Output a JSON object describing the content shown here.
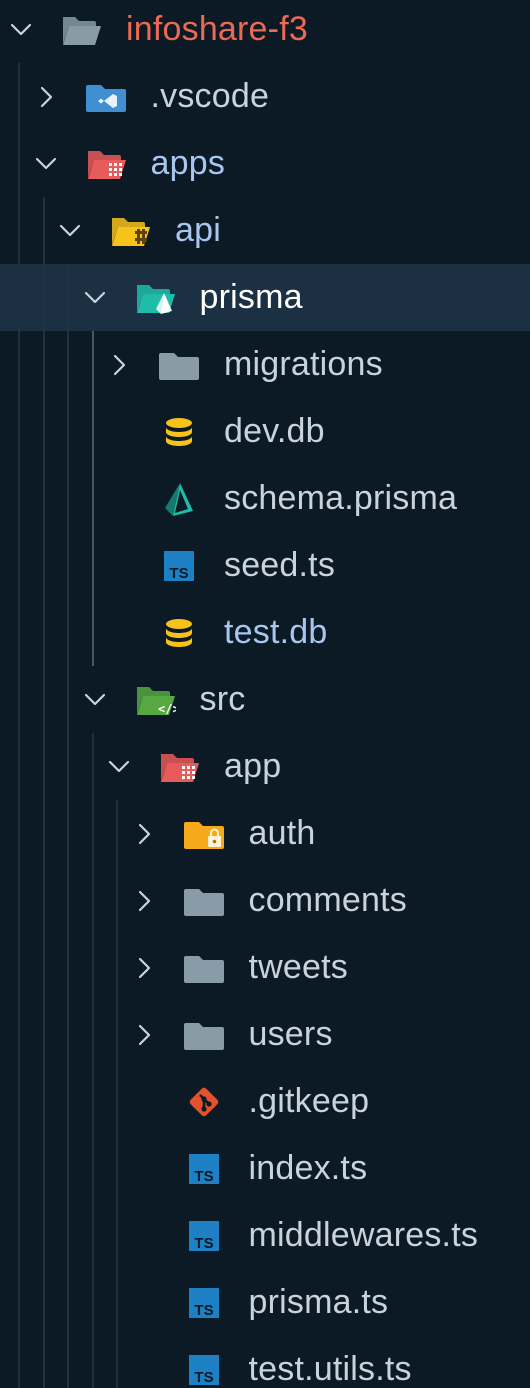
{
  "explorer": {
    "items": [
      {
        "label": "infoshare-f3",
        "depth": 0,
        "expanded": true,
        "type": "folder-root",
        "color": "#ec6a55"
      },
      {
        "label": ".vscode",
        "depth": 1,
        "expanded": false,
        "type": "folder-vscode",
        "color": "#c9d3dc"
      },
      {
        "label": "apps",
        "depth": 1,
        "expanded": true,
        "type": "folder-apps",
        "color": "#a9c6ee"
      },
      {
        "label": "api",
        "depth": 2,
        "expanded": true,
        "type": "folder-api",
        "color": "#a9c6ee"
      },
      {
        "label": "prisma",
        "depth": 3,
        "expanded": true,
        "type": "folder-prisma",
        "color": "#ffffff",
        "selected": true
      },
      {
        "label": "migrations",
        "depth": 4,
        "expanded": false,
        "type": "folder-generic",
        "color": "#c9d3dc"
      },
      {
        "label": "dev.db",
        "depth": 4,
        "type": "file-db",
        "color": "#c9d3dc"
      },
      {
        "label": "schema.prisma",
        "depth": 4,
        "type": "file-prisma",
        "color": "#c9d3dc"
      },
      {
        "label": "seed.ts",
        "depth": 4,
        "type": "file-ts",
        "color": "#c9d3dc"
      },
      {
        "label": "test.db",
        "depth": 4,
        "type": "file-db",
        "color": "#a9c6ee"
      },
      {
        "label": "src",
        "depth": 3,
        "expanded": true,
        "type": "folder-src",
        "color": "#c9d3dc"
      },
      {
        "label": "app",
        "depth": 4,
        "expanded": true,
        "type": "folder-apps",
        "color": "#c9d3dc"
      },
      {
        "label": "auth",
        "depth": 5,
        "expanded": false,
        "type": "folder-auth",
        "color": "#c9d3dc"
      },
      {
        "label": "comments",
        "depth": 5,
        "expanded": false,
        "type": "folder-generic",
        "color": "#c9d3dc"
      },
      {
        "label": "tweets",
        "depth": 5,
        "expanded": false,
        "type": "folder-generic",
        "color": "#c9d3dc"
      },
      {
        "label": "users",
        "depth": 5,
        "expanded": false,
        "type": "folder-generic",
        "color": "#c9d3dc"
      },
      {
        "label": ".gitkeep",
        "depth": 5,
        "type": "file-git",
        "color": "#c9d3dc"
      },
      {
        "label": "index.ts",
        "depth": 5,
        "type": "file-ts",
        "color": "#c9d3dc"
      },
      {
        "label": "middlewares.ts",
        "depth": 5,
        "type": "file-ts",
        "color": "#c9d3dc"
      },
      {
        "label": "prisma.ts",
        "depth": 5,
        "type": "file-ts",
        "color": "#c9d3dc"
      },
      {
        "label": "test.utils.ts",
        "depth": 5,
        "type": "file-ts",
        "color": "#c9d3dc"
      }
    ]
  },
  "icon_names": {
    "folder-root": "open-folder-icon",
    "folder-vscode": "vscode-folder-icon",
    "folder-apps": "apps-folder-icon",
    "folder-api": "api-folder-icon",
    "folder-prisma": "prisma-folder-icon",
    "folder-generic": "folder-icon",
    "folder-src": "src-folder-icon",
    "folder-auth": "auth-folder-icon",
    "file-db": "database-icon",
    "file-prisma": "prisma-file-icon",
    "file-ts": "typescript-icon",
    "file-git": "git-icon"
  },
  "colors": {
    "background": "#0b1a25",
    "selection": "#1b3042",
    "chevron": "#c9d3dc",
    "guide": "#23313d",
    "folder_grey": "#8a9ba8",
    "typescript_blue": "#1d7fc4",
    "database_yellow": "#f7c21a",
    "prisma_teal": "#1fbcaa",
    "git_orange": "#e4512b"
  }
}
